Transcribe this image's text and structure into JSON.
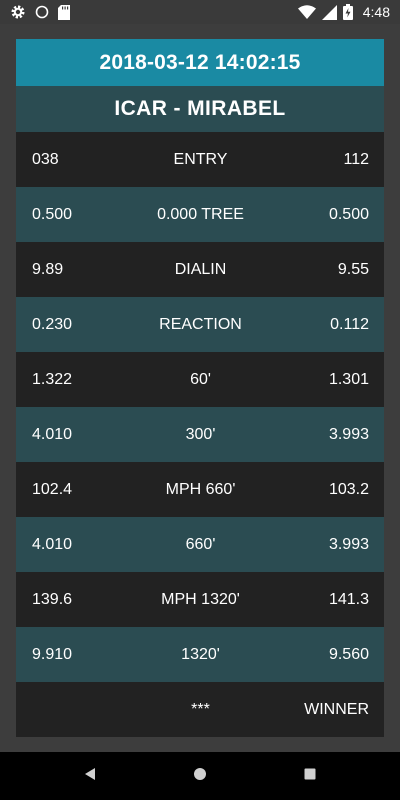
{
  "status_bar": {
    "time": "4:48",
    "icons": [
      "gear-icon",
      "circle-icon",
      "sd-card-icon",
      "wifi-icon",
      "signal-icon",
      "battery-icon"
    ]
  },
  "header": {
    "datetime": "2018-03-12 14:02:15",
    "track": "ICAR - MIRABEL"
  },
  "rows": [
    {
      "left": "038",
      "label": "ENTRY",
      "right": "112"
    },
    {
      "left": "0.500",
      "label": "0.000 TREE",
      "right": "0.500"
    },
    {
      "left": "9.89",
      "label": "DIALIN",
      "right": "9.55"
    },
    {
      "left": "0.230",
      "label": "REACTION",
      "right": "0.112"
    },
    {
      "left": "1.322",
      "label": "60'",
      "right": "1.301"
    },
    {
      "left": "4.010",
      "label": "300'",
      "right": "3.993"
    },
    {
      "left": "102.4",
      "label": "MPH 660'",
      "right": "103.2"
    },
    {
      "left": "4.010",
      "label": "660'",
      "right": "3.993"
    },
    {
      "left": "139.6",
      "label": "MPH 1320'",
      "right": "141.3"
    },
    {
      "left": "9.910",
      "label": "1320'",
      "right": "9.560"
    },
    {
      "left": "",
      "label": "***",
      "right": "WINNER"
    }
  ],
  "nav": {
    "icons": [
      "back-icon",
      "home-icon",
      "recents-icon"
    ]
  },
  "colors": {
    "header_accent": "#1a8aa3",
    "row_teal": "#2b4c52",
    "row_dark": "#222222"
  }
}
